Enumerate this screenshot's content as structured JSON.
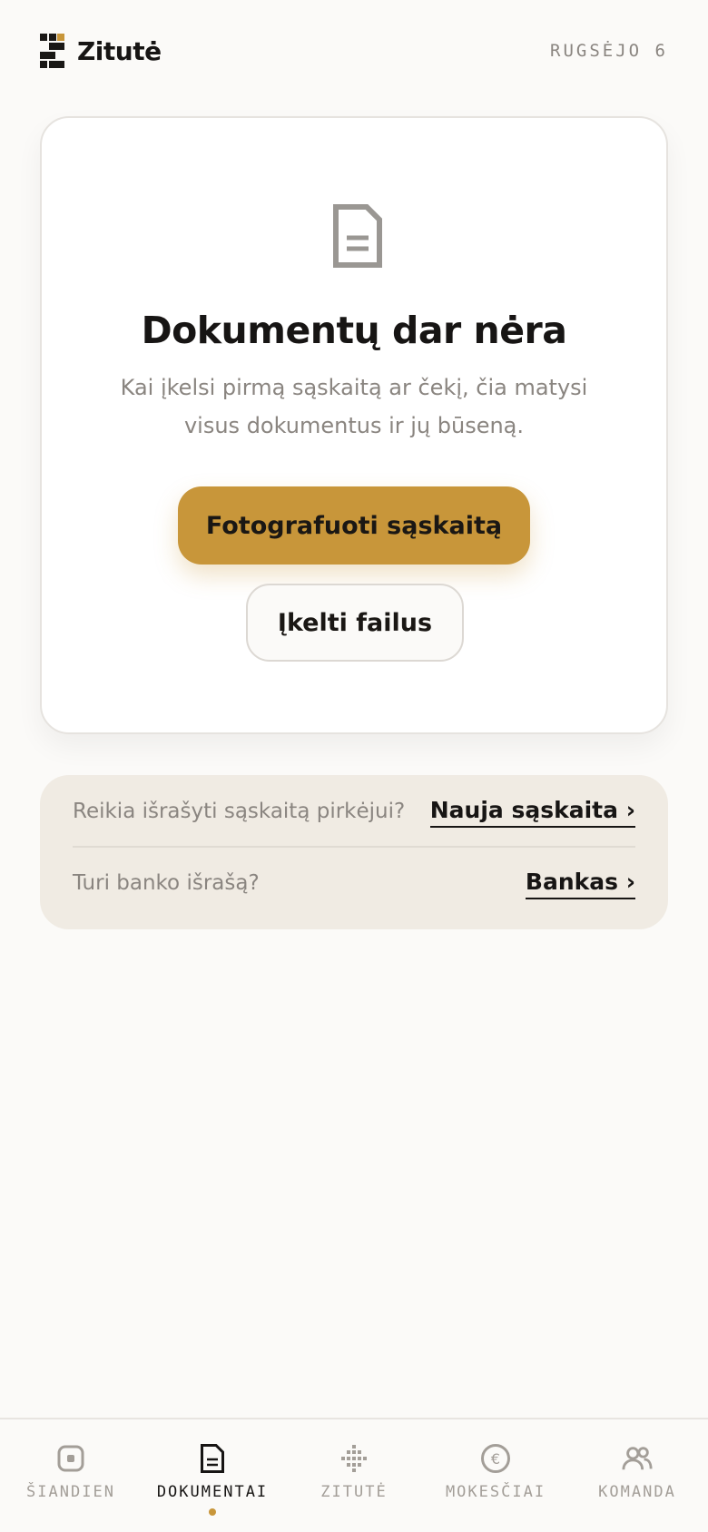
{
  "header": {
    "brand": "Zitutė",
    "date": "RUGSĖJO 6"
  },
  "empty_state": {
    "icon": "document-icon",
    "title": "Dokumentų dar nėra",
    "description": "Kai įkelsi pirmą sąskaitą ar čekį, čia matysi visus dokumentus ir jų būseną.",
    "primary_button": "Fotografuoti sąskaitą",
    "secondary_button": "Įkelti failus"
  },
  "links": [
    {
      "question": "Reikia išrašyti sąskaitą pirkėjui?",
      "action": "Nauja sąskaita ›"
    },
    {
      "question": "Turi banko išrašą?",
      "action": "Bankas ›"
    }
  ],
  "nav": {
    "items": [
      {
        "label": "ŠIANDIEN",
        "icon": "today-icon",
        "active": false
      },
      {
        "label": "DOKUMENTAI",
        "icon": "document-icon",
        "active": true
      },
      {
        "label": "ZITUTĖ",
        "icon": "sparkle-icon",
        "active": false
      },
      {
        "label": "MOKESČIAI",
        "icon": "euro-icon",
        "active": false
      },
      {
        "label": "KOMANDA",
        "icon": "team-icon",
        "active": false
      }
    ]
  },
  "colors": {
    "accent": "#c8963a",
    "background": "#fbfaf8",
    "panel": "#f0ebe3",
    "text": "#171514",
    "muted": "#8a8580"
  }
}
